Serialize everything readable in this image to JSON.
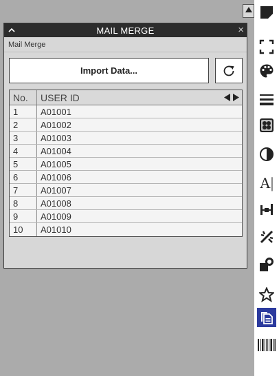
{
  "panel": {
    "title": "MAIL MERGE",
    "close_glyph": "×",
    "subtitle": "Mail Merge",
    "import_label": "Import Data...",
    "columns": {
      "no": "No.",
      "user_id": "USER ID"
    },
    "rows": [
      {
        "no": "1",
        "id": "A01001"
      },
      {
        "no": "2",
        "id": "A01002"
      },
      {
        "no": "3",
        "id": "A01003"
      },
      {
        "no": "4",
        "id": "A01004"
      },
      {
        "no": "5",
        "id": "A01005"
      },
      {
        "no": "6",
        "id": "A01006"
      },
      {
        "no": "7",
        "id": "A01007"
      },
      {
        "no": "8",
        "id": "A01008"
      },
      {
        "no": "9",
        "id": "A01009"
      },
      {
        "no": "10",
        "id": "A01010"
      }
    ]
  },
  "toolbar": {
    "text_tool_glyph": "A|",
    "icons": [
      "page-corner-icon",
      "crop-icon",
      "palette-icon",
      "lines-icon",
      "pattern-icon",
      "contrast-icon",
      "text-cursor-icon",
      "distribute-icon",
      "magic-icon",
      "shapes-icon",
      "star-icon",
      "mail-merge-icon",
      "barcode-icon"
    ],
    "active_color": "#2b3a9e"
  }
}
